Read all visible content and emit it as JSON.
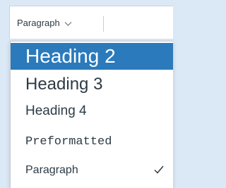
{
  "toolbar": {
    "block_format_value": "Paragraph",
    "chevron_icon": "chevron-down-icon"
  },
  "dropdown": {
    "items": [
      {
        "label": "Heading 2",
        "selected": true
      },
      {
        "label": "Heading 3"
      },
      {
        "label": "Heading 4"
      },
      {
        "label": "Preformatted"
      },
      {
        "label": "Paragraph",
        "checked": true,
        "check_icon": "checkmark-icon"
      }
    ],
    "highlight_color": "#2b7abc"
  }
}
